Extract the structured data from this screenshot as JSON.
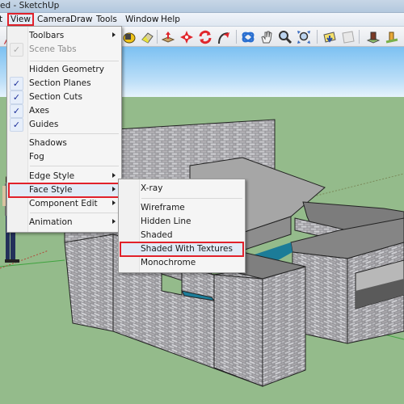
{
  "window": {
    "title": "ed - SketchUp"
  },
  "menubar": {
    "items": [
      {
        "label": "View",
        "active": true
      },
      {
        "label": "Camera"
      },
      {
        "label": "Draw"
      },
      {
        "label": "Tools"
      },
      {
        "label": "Window"
      },
      {
        "label": "Help"
      }
    ]
  },
  "toolbar": {
    "icons": [
      "paint-bucket-icon",
      "eraser-icon",
      "push-pull-icon",
      "move-icon",
      "rotate-icon",
      "follow-me-icon",
      "orbit-icon",
      "pan-icon",
      "zoom-icon",
      "zoom-extents-icon",
      "get-models-icon",
      "share-model-icon",
      "3d-warehouse-icon",
      "component-icon"
    ]
  },
  "view_menu": {
    "items": [
      {
        "label": "Toolbars",
        "submenu": true
      },
      {
        "label": "Scene Tabs",
        "checked": true,
        "disabled": true
      },
      {
        "label": "Hidden Geometry"
      },
      {
        "label": "Section Planes",
        "checked": true
      },
      {
        "label": "Section Cuts",
        "checked": true
      },
      {
        "label": "Axes",
        "checked": true
      },
      {
        "label": "Guides",
        "checked": true
      },
      {
        "label": "Shadows"
      },
      {
        "label": "Fog"
      },
      {
        "label": "Edge Style",
        "submenu": true
      },
      {
        "label": "Face Style",
        "submenu": true,
        "highlighted": true
      },
      {
        "label": "Component Edit",
        "submenu": true
      },
      {
        "label": "Animation",
        "submenu": true
      }
    ],
    "check_mark": "✓"
  },
  "face_style_submenu": {
    "items": [
      {
        "label": "X-ray"
      },
      {
        "label": "Wireframe"
      },
      {
        "label": "Hidden Line"
      },
      {
        "label": "Shaded"
      },
      {
        "label": "Shaded With Textures",
        "highlighted": true
      },
      {
        "label": "Monochrome"
      }
    ]
  },
  "colors": {
    "highlight_outline": "#e1212b",
    "sky": "#7cc1f2",
    "ground": "#94bb8b",
    "check": "#1d2f9a"
  }
}
